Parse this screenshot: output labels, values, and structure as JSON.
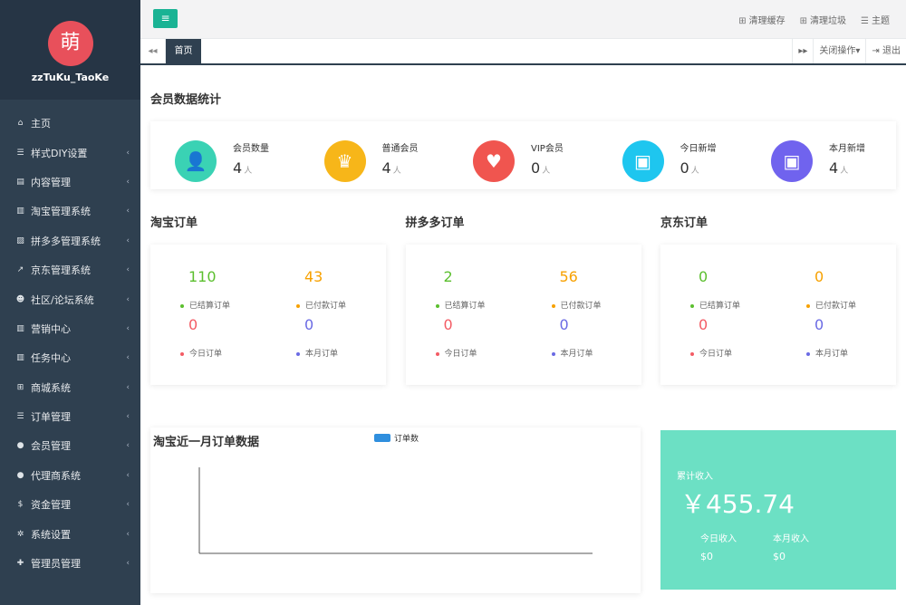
{
  "sidebar": {
    "avatar_char": "萌",
    "username": "zzTuKu_TaoKe",
    "items": [
      {
        "icon": "home-icon",
        "glyph": "⌂",
        "label": "主页",
        "has_children": false
      },
      {
        "icon": "list-icon",
        "glyph": "☰",
        "label": "样式DIY设置",
        "has_children": true
      },
      {
        "icon": "file-icon",
        "glyph": "▤",
        "label": "内容管理",
        "has_children": true
      },
      {
        "icon": "bar-chart-icon",
        "glyph": "▥",
        "label": "淘宝管理系统",
        "has_children": true
      },
      {
        "icon": "area-chart-icon",
        "glyph": "▨",
        "label": "拼多多管理系统",
        "has_children": true
      },
      {
        "icon": "line-chart-icon",
        "glyph": "↗",
        "label": "京东管理系统",
        "has_children": true
      },
      {
        "icon": "users-icon",
        "glyph": "☻",
        "label": "社区/论坛系统",
        "has_children": true
      },
      {
        "icon": "bar-chart-icon",
        "glyph": "▥",
        "label": "营销中心",
        "has_children": true
      },
      {
        "icon": "bar-chart-icon",
        "glyph": "▥",
        "label": "任务中心",
        "has_children": true
      },
      {
        "icon": "cart-icon",
        "glyph": "⊞",
        "label": "商城系统",
        "has_children": true
      },
      {
        "icon": "list-icon",
        "glyph": "☰",
        "label": "订单管理",
        "has_children": true
      },
      {
        "icon": "user-icon",
        "glyph": "●",
        "label": "会员管理",
        "has_children": true
      },
      {
        "icon": "user-secret-icon",
        "glyph": "●",
        "label": "代理商系统",
        "has_children": true
      },
      {
        "icon": "dollar-icon",
        "glyph": "$",
        "label": "资金管理",
        "has_children": true
      },
      {
        "icon": "gear-icon",
        "glyph": "✲",
        "label": "系统设置",
        "has_children": true
      },
      {
        "icon": "user-plus-icon",
        "glyph": "✚",
        "label": "管理员管理",
        "has_children": true
      }
    ],
    "chevron": "‹"
  },
  "topbar": {
    "toggle_glyph": "≡",
    "links": [
      {
        "icon": "cart-icon",
        "glyph": "⊞",
        "label": "清理缓存"
      },
      {
        "icon": "cart-icon",
        "glyph": "⊞",
        "label": "清理垃圾"
      },
      {
        "icon": "theme-icon",
        "glyph": "☰",
        "label": "主题"
      }
    ]
  },
  "tabs": {
    "back_glyph": "◂◂",
    "forward_glyph": "▸▸",
    "active": "首页",
    "close_ops": "关闭操作▾",
    "logout_glyph": "⇥",
    "logout": "退出"
  },
  "member_stats": {
    "title": "会员数据统计",
    "unit": "人",
    "items": [
      {
        "label": "会员数量",
        "value": "4",
        "icon": "user-icon",
        "glyph": "👤",
        "color": "#3ad2b4"
      },
      {
        "label": "普通会员",
        "value": "4",
        "icon": "crown-icon",
        "glyph": "♛",
        "color": "#f7b619"
      },
      {
        "label": "VIP会员",
        "value": "0",
        "icon": "heart-check-icon",
        "glyph": "♥",
        "color": "#f0554f"
      },
      {
        "label": "今日新增",
        "value": "0",
        "icon": "calendar-check-icon",
        "glyph": "▣",
        "color": "#1ec6ef"
      },
      {
        "label": "本月新增",
        "value": "4",
        "icon": "calendar-check-icon",
        "glyph": "▣",
        "color": "#7063ee"
      }
    ]
  },
  "orders": [
    {
      "title": "淘宝订单",
      "settled": "110",
      "paid": "43",
      "today": "0",
      "month": "0"
    },
    {
      "title": "拼多多订单",
      "settled": "2",
      "paid": "56",
      "today": "0",
      "month": "0"
    },
    {
      "title": "京东订单",
      "settled": "0",
      "paid": "0",
      "today": "0",
      "month": "0"
    }
  ],
  "order_labels": {
    "settled": "已结算订单",
    "paid": "已付款订单",
    "today": "今日订单",
    "month": "本月订单"
  },
  "order_colors": {
    "settled": "#5bbf2e",
    "paid": "#f7a100",
    "today": "#f35b64",
    "month": "#6a6ae4"
  },
  "chart": {
    "title": "淘宝近一月订单数据",
    "legend": "订单数",
    "legend_color": "#2f8fde"
  },
  "chart_data": {
    "type": "bar",
    "title": "淘宝近一月订单数据",
    "series": [
      {
        "name": "订单数",
        "values": []
      }
    ],
    "categories": [],
    "legend": "top"
  },
  "income": {
    "title": "累计收入",
    "total": "￥455.74",
    "today_label": "今日收入",
    "today_value": "$0",
    "month_label": "本月收入",
    "month_value": "$0",
    "color": "#6ce0c4"
  }
}
